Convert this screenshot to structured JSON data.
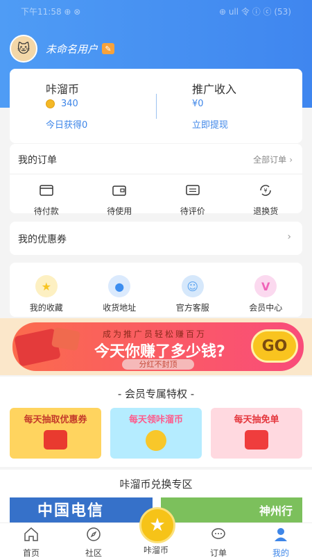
{
  "status_bar": {
    "left": "下午11:58 ⊕ ⊗",
    "right": "⊕ ull 令 ⓘ ⓒ (53)"
  },
  "user": {
    "name": "未命名用户"
  },
  "wallet": {
    "left": {
      "title": "咔溜币",
      "value": "340",
      "link": "今日获得0"
    },
    "right": {
      "title": "推广收入",
      "value": "¥0",
      "link": "立即提现"
    }
  },
  "orders": {
    "title": "我的订单",
    "all_label": "全部订单",
    "items": [
      {
        "label": "待付款",
        "icon": "wallet-icon"
      },
      {
        "label": "待使用",
        "icon": "card-icon"
      },
      {
        "label": "待评价",
        "icon": "comment-icon"
      },
      {
        "label": "退换货",
        "icon": "refund-icon"
      }
    ]
  },
  "coupons": {
    "title": "我的优惠券"
  },
  "services": [
    {
      "label": "我的收藏",
      "icon": "star-icon",
      "color": "#f7c423",
      "glyph": "★"
    },
    {
      "label": "收货地址",
      "icon": "location-pin-icon",
      "color": "#3d8ef0",
      "glyph": "●"
    },
    {
      "label": "官方客服",
      "icon": "customer-service-icon",
      "color": "#5aa3f0",
      "glyph": "☺"
    },
    {
      "label": "会员中心",
      "icon": "vip-icon",
      "color": "#f064b8",
      "glyph": "V"
    }
  ],
  "banner": {
    "subtitle": "成为推广员轻松赚百万",
    "headline": "今天你赚了多少钱?",
    "pill": "分红不封顶",
    "go": "GO"
  },
  "vip": {
    "title": "- 会员专属特权 -",
    "tiles": [
      "每天抽取优惠券",
      "每天领咔溜币",
      "每天抽免单"
    ]
  },
  "exchange": {
    "title": "咔溜币兑换专区",
    "items": [
      "中国电信",
      "神州行"
    ]
  },
  "tabbar": {
    "items": [
      {
        "label": "首页",
        "icon": "home-icon",
        "active": false
      },
      {
        "label": "社区",
        "icon": "compass-icon",
        "active": false
      },
      {
        "label": "咔溜币",
        "icon": "star-coin-icon",
        "active": false
      },
      {
        "label": "订单",
        "icon": "chat-bubble-icon",
        "active": false
      },
      {
        "label": "我的",
        "icon": "person-icon",
        "active": true
      }
    ]
  },
  "colors": {
    "primary": "#3e86e8",
    "accent": "#f6c318"
  }
}
